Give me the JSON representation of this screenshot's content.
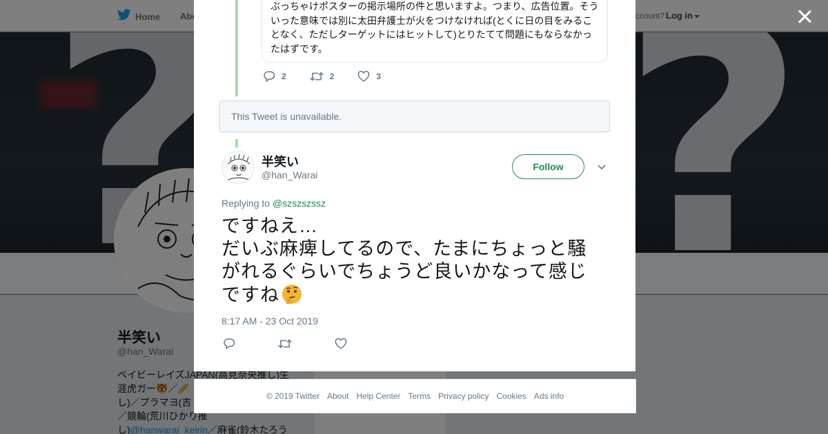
{
  "nav": {
    "home": "Home",
    "about": "Abo",
    "account_prompt": "ccount?",
    "login": "Log in"
  },
  "profile": {
    "name": "半笑い",
    "handle": "@han_Warai",
    "bio_lines": [
      "ベイビーレイズJAPAN(高見奈央推し)生",
      "涯虎ガー🐯／🥖",
      "し)／プラマヨ(吉",
      "／競輪(荒川ひかり推"
    ],
    "bio_link_prefix": "し)",
    "bio_link": "@hanwarai_keirin",
    "bio_link_suffix": "／麻雀(鈴木たろう",
    "card_text": "Ads info"
  },
  "quoted": {
    "text": "ぶっちゃけポスターの掲示場所の件と思いますよ。つまり、広告位置。そういった意味では別に太田弁護士が火をつけなければ(とくに日の目をみることなく、ただしターゲットにはヒットして)とりたてて問題にもならなかったはずです。",
    "replies": "2",
    "retweets": "2",
    "likes": "3"
  },
  "unavailable": "This Tweet is unavailable.",
  "tweet": {
    "name": "半笑い",
    "handle": "@han_Warai",
    "follow": "Follow",
    "replying_label": "Replying to",
    "replying_handle": "@szszszssz",
    "line1": "ですねえ…",
    "line2": "だいぶ麻痺してるので、たまにちょっと騒がれるぐらいでちょうど良いかなって感じですね",
    "emoji": "thinking-face-emoji",
    "time": "8:17 AM - 23 Oct 2019"
  },
  "footer": [
    "© 2019 Twitter",
    "About",
    "Help Center",
    "Terms",
    "Privacy policy",
    "Cookies",
    "Ads info"
  ],
  "colors": {
    "accent_green": "#1c8d4a",
    "thread_line": "#a5d8b9",
    "secondary_text": "#657786",
    "twitter_blue": "#1da1f2"
  }
}
